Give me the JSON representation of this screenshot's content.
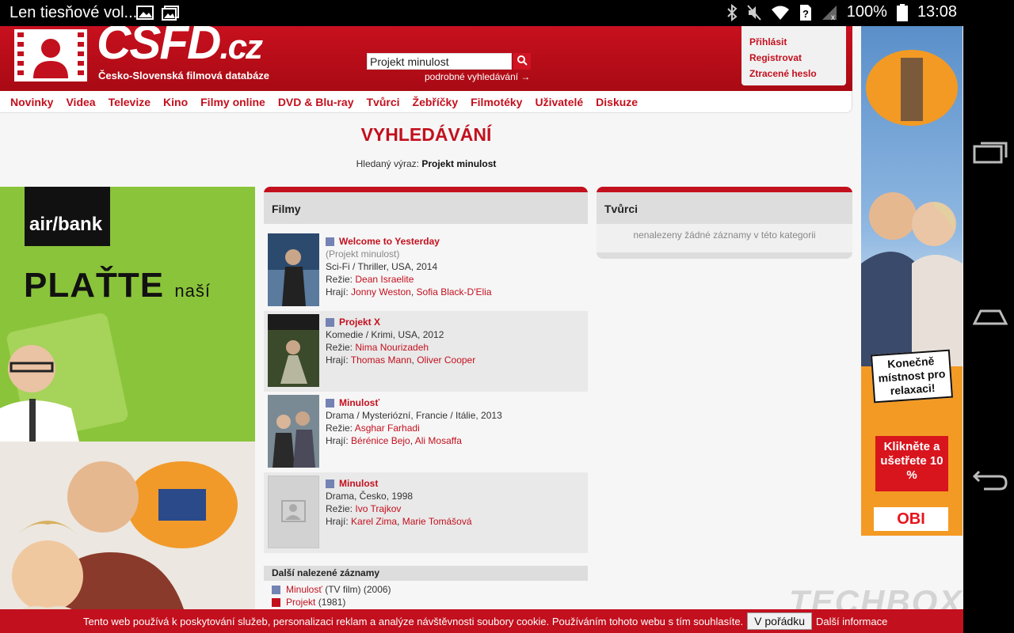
{
  "statusbar": {
    "notification": "Len tiesňové vol...",
    "battery": "100%",
    "time": "13:08"
  },
  "site": {
    "logo_main": "ČSFD",
    "logo_suffix": ".cz",
    "logo_subtitle": "Česko-Slovenská filmová databáze"
  },
  "search": {
    "value": "Projekt minulost",
    "advanced_link": "podrobné vyhledávání →"
  },
  "login": {
    "sign_in": "Přihlásit",
    "register": "Registrovat",
    "lost_password": "Ztracené heslo"
  },
  "menu": [
    "Novinky",
    "Videa",
    "Televize",
    "Kino",
    "Filmy online",
    "DVD & Blu-ray",
    "Tvůrci",
    "Žebříčky",
    "Filmotéky",
    "Uživatelé",
    "Diskuze"
  ],
  "page": {
    "title": "VYHLEDÁVÁNÍ",
    "query_label": "Hledaný výraz:",
    "query_value": "Projekt minulost"
  },
  "films": {
    "heading": "Filmy",
    "items": [
      {
        "title": "Welcome to Yesterday",
        "original": "(Projekt minulost)",
        "genre": "Sci-Fi / Thriller, USA, 2014",
        "director_label": "Režie:",
        "director": "Dean Israelite",
        "cast_label": "Hrají:",
        "cast1": "Jonny Weston",
        "sep": ",",
        "cast2": "Sofia Black-D'Elia",
        "poster_color": "#2c4a6e"
      },
      {
        "title": "Projekt X",
        "genre": "Komedie / Krimi, USA, 2012",
        "director_label": "Režie:",
        "director": "Nima Nourizadeh",
        "cast_label": "Hrají:",
        "cast1": "Thomas Mann",
        "sep": ",",
        "cast2": "Oliver Cooper",
        "poster_color": "#3b4a2a"
      },
      {
        "title": "Minulosť",
        "genre": "Drama / Mysteriózní, Francie / Itálie, 2013",
        "director_label": "Režie:",
        "director": "Asghar Farhadi",
        "cast_label": "Hrají:",
        "cast1": "Bérénice Bejo",
        "sep": ",",
        "cast2": "Ali Mosaffa",
        "poster_color": "#7a8a94"
      },
      {
        "title": "Minulost",
        "genre": "Drama, Česko, 1998",
        "director_label": "Režie:",
        "director": "Ivo Trajkov",
        "cast_label": "Hrají:",
        "cast1": "Karel Zima",
        "sep": ",",
        "cast2": "Marie Tomášová",
        "poster_color": "#d2d2d2"
      }
    ]
  },
  "more": {
    "heading": "Další nalezené záznamy",
    "items": [
      {
        "title": "Minulosť",
        "extra": "(TV film) (2006)"
      },
      {
        "title": "Projekt",
        "extra": "(1981)"
      }
    ]
  },
  "creators": {
    "heading": "Tvůrci",
    "empty": "nenalezeny žádné záznamy v této kategorii"
  },
  "ad_left": {
    "brand": "air/bank",
    "claim": "PLAŤTE",
    "claim_small": "naší"
  },
  "ad_right": {
    "tag": "Konečně místnost pro relaxaci!",
    "offer": "Klikněte a ušetřete 10 %",
    "brand": "OBI"
  },
  "watermark": "TECHBOX",
  "cookie": {
    "text": "Tento web používá k poskytování služeb, personalizaci reklam a analýze návštěvnosti soubory cookie. Používáním tohoto webu s tím souhlasíte.",
    "ok": "V pořádku",
    "info": "Další informace"
  }
}
